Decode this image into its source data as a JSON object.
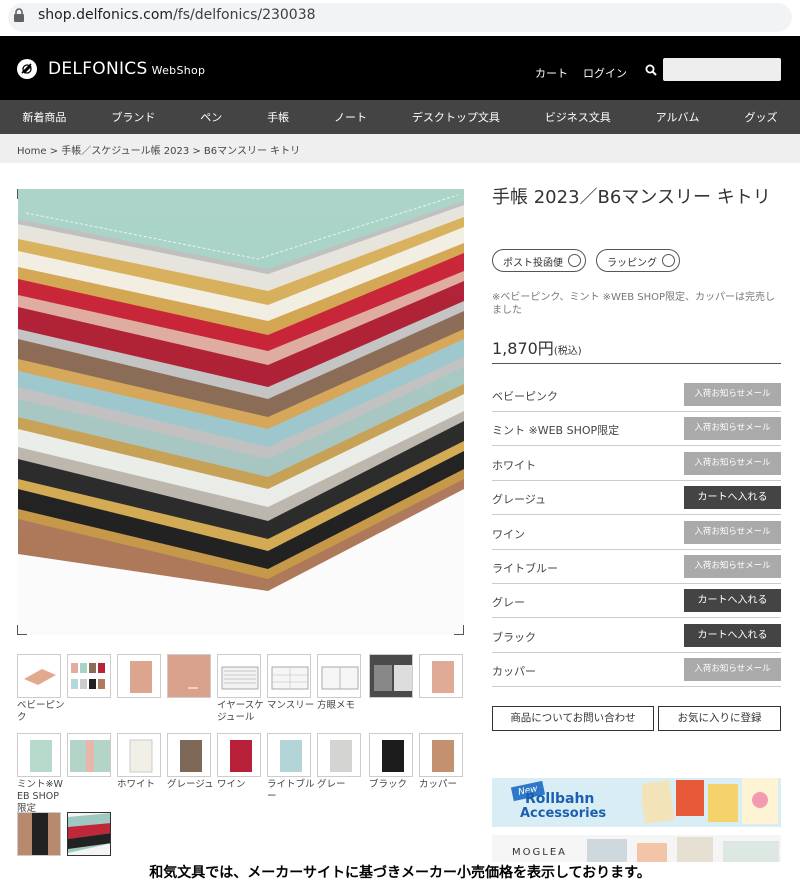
{
  "browser": {
    "url_host": "shop.delfonics.com",
    "url_path": "/fs/delfonics/230038"
  },
  "header": {
    "brand": "DELFONICS",
    "brand_sub": "WebShop",
    "cart": "カート",
    "login": "ログイン"
  },
  "nav": [
    "新着商品",
    "ブランド",
    "ペン",
    "手帳",
    "ノート",
    "デスクトップ文具",
    "ビジネス文具",
    "アルバム",
    "グッズ"
  ],
  "breadcrumb": "Home > 手帳／スケジュール帳 2023 > B6マンスリー キトリ",
  "product": {
    "title": "手帳 2023／B6マンスリー キトリ",
    "tags": [
      "ポスト投函便",
      "ラッピング"
    ],
    "note": "※ベビーピンク、ミント ※WEB SHOP限定、カッパーは完売しました",
    "price": "1,870円",
    "tax": "(税込)",
    "variants": [
      {
        "name": "ベビーピンク",
        "button": "入荷お知らせメール",
        "kind": "notify"
      },
      {
        "name": "ミント ※WEB SHOP限定",
        "button": "入荷お知らせメール",
        "kind": "notify"
      },
      {
        "name": "ホワイト",
        "button": "入荷お知らせメール",
        "kind": "notify"
      },
      {
        "name": "グレージュ",
        "button": "カートへ入れる",
        "kind": "cart"
      },
      {
        "name": "ワイン",
        "button": "入荷お知らせメール",
        "kind": "notify"
      },
      {
        "name": "ライトブルー",
        "button": "入荷お知らせメール",
        "kind": "notify"
      },
      {
        "name": "グレー",
        "button": "カートへ入れる",
        "kind": "cart"
      },
      {
        "name": "ブラック",
        "button": "カートへ入れる",
        "kind": "cart"
      },
      {
        "name": "カッパー",
        "button": "入荷お知らせメール",
        "kind": "notify"
      }
    ],
    "inquiry": "商品についてお問い合わせ",
    "favorite": "お気に入りに登録"
  },
  "thumb_labels": {
    "r1": [
      "ベビーピンク",
      "",
      "",
      "",
      "イヤースケジュール",
      "マンスリー",
      "方眼メモ",
      "",
      ""
    ],
    "r2": [
      "ミント※WEB SHOP限定",
      "",
      "ホワイト",
      "グレージュ",
      "ワイン",
      "ライトブルー",
      "グレー",
      "ブラック",
      "カッパー"
    ]
  },
  "banners": {
    "new": "New",
    "rollbahn1": "Rollbahn",
    "rollbahn2": "Accessories",
    "moglea": "MOGLEA"
  },
  "footer_note": "和気文具では、メーカーサイトに基づきメーカー小売価格を表示しております。",
  "colors": {
    "header_bg": "#000000",
    "nav_bg": "#444444",
    "notify_btn": "#aaaaaa",
    "cart_btn": "#444444"
  }
}
